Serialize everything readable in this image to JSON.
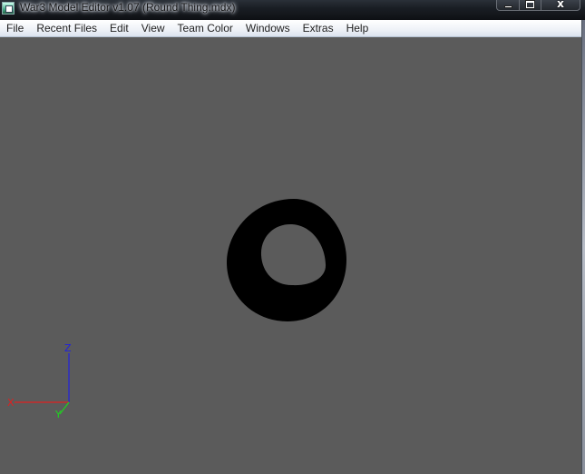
{
  "window": {
    "title": "War3 Model Editor v1.07 (Round Thing.mdx)",
    "close_glyph": "x"
  },
  "menu": [
    {
      "label": "File",
      "name": "menu-file"
    },
    {
      "label": "Recent Files",
      "name": "menu-recent-files"
    },
    {
      "label": "Edit",
      "name": "menu-edit"
    },
    {
      "label": "View",
      "name": "menu-view"
    },
    {
      "label": "Team Color",
      "name": "menu-team-color"
    },
    {
      "label": "Windows",
      "name": "menu-windows"
    },
    {
      "label": "Extras",
      "name": "menu-extras"
    },
    {
      "label": "Help",
      "name": "menu-help"
    }
  ],
  "viewport": {
    "background_color": "#5b5b5b",
    "model_color": "#000000",
    "axes": {
      "x_label": "X",
      "y_label": "Y",
      "z_label": "Z",
      "x_color": "#e02020",
      "y_color": "#20d020",
      "z_color": "#2020e0"
    }
  }
}
